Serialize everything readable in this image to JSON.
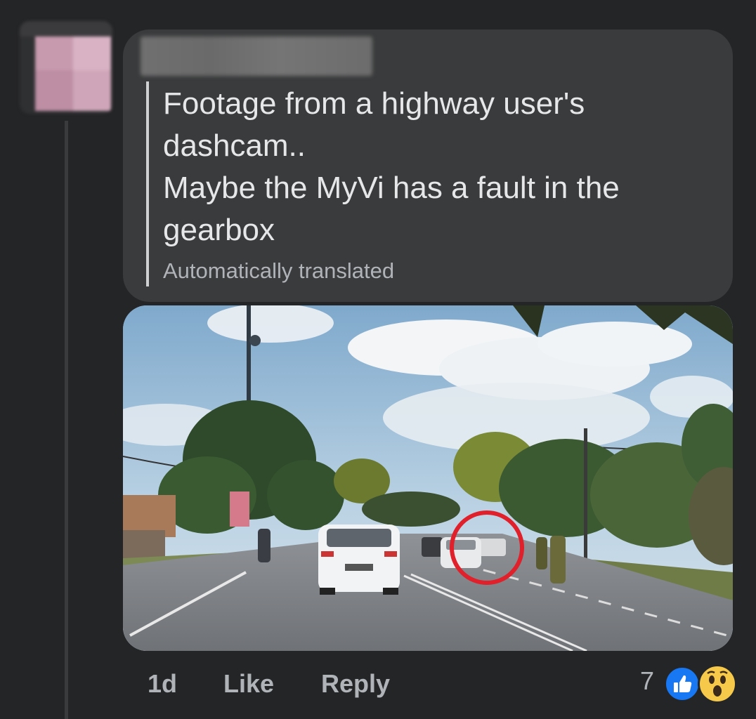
{
  "comment": {
    "author_redacted": true,
    "text": "Footage from a highway user's\ndashcam..\nMaybe the MyVi has a fault in the\ngearbox",
    "translation_note": "Automatically translated"
  },
  "attachment": {
    "type": "photo",
    "highlight_color": "#e0202a"
  },
  "actions": {
    "time": "1d",
    "like_label": "Like",
    "reply_label": "Reply"
  },
  "reactions": {
    "count": "7",
    "types": [
      "like-icon",
      "wow-icon"
    ],
    "like_color": "#1877f2",
    "wow_color": "#f7c94b"
  }
}
